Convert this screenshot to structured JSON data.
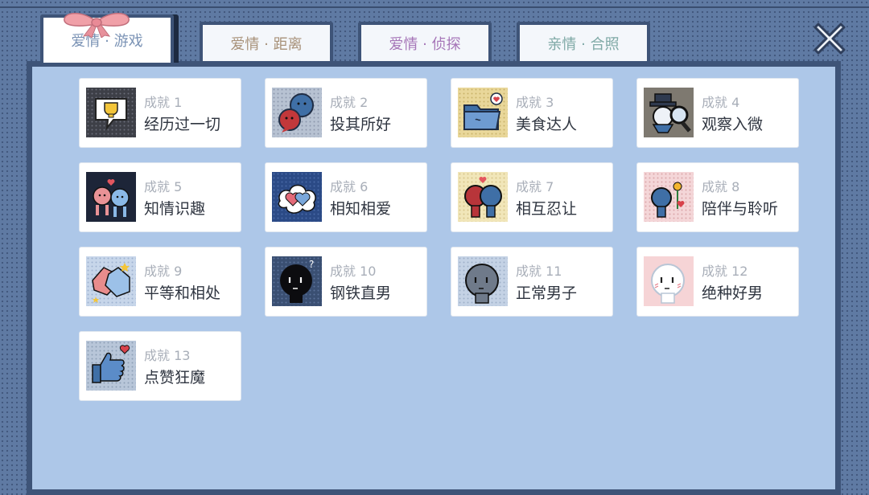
{
  "tabs": [
    {
      "label": "爱情 · 游戏",
      "color": "#7b93b5",
      "active": true
    },
    {
      "label": "爱情 · 距离",
      "color": "#a8927a",
      "active": false
    },
    {
      "label": "爱情 · 侦探",
      "color": "#a676b8",
      "active": false
    },
    {
      "label": "亲情 · 合照",
      "color": "#7fa9a6",
      "active": false
    }
  ],
  "close_icon": "close-x-icon",
  "achievements": [
    {
      "title": "成就 1",
      "name": "经历过一切",
      "icon": "trophy-speech-icon"
    },
    {
      "title": "成就 2",
      "name": "投其所好",
      "icon": "two-bubbles-icon"
    },
    {
      "title": "成就 3",
      "name": "美食达人",
      "icon": "folder-heart-icon"
    },
    {
      "title": "成就 4",
      "name": "观察入微",
      "icon": "detective-magnifier-icon"
    },
    {
      "title": "成就 5",
      "name": "知情识趣",
      "icon": "couple-heart-icon"
    },
    {
      "title": "成就 6",
      "name": "相知相爱",
      "icon": "heart-cloud-icon"
    },
    {
      "title": "成就 7",
      "name": "相互忍让",
      "icon": "couple-heads-icon"
    },
    {
      "title": "成就 8",
      "name": "陪伴与聆听",
      "icon": "flower-person-icon"
    },
    {
      "title": "成就 9",
      "name": "平等和相处",
      "icon": "handshake-icon"
    },
    {
      "title": "成就 10",
      "name": "钢铁直男",
      "icon": "black-face-icon"
    },
    {
      "title": "成就 11",
      "name": "正常男子",
      "icon": "gray-face-icon"
    },
    {
      "title": "成就 12",
      "name": "绝种好男",
      "icon": "white-face-icon"
    },
    {
      "title": "成就 13",
      "name": "点赞狂魔",
      "icon": "thumbs-up-heart-icon"
    }
  ]
}
